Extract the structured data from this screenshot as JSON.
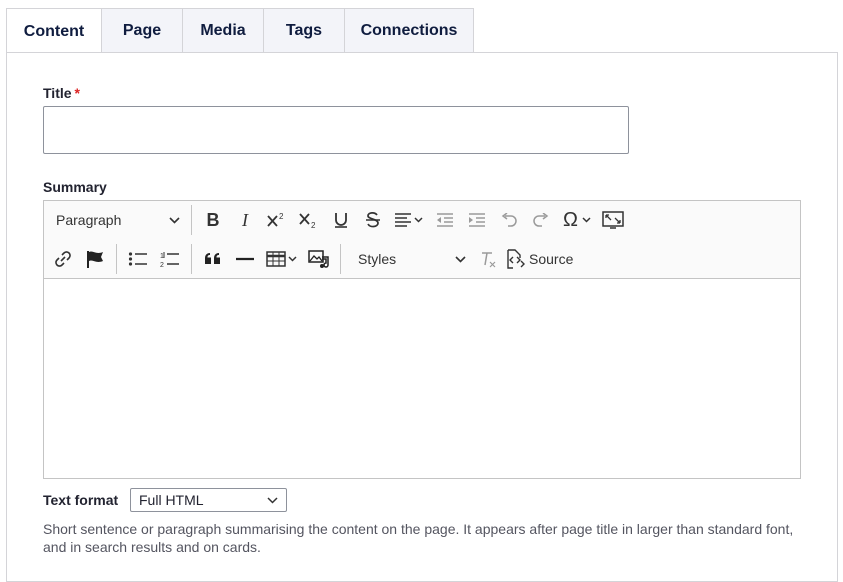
{
  "tabs": [
    {
      "label": "Content",
      "active": true
    },
    {
      "label": "Page",
      "active": false
    },
    {
      "label": "Media",
      "active": false
    },
    {
      "label": "Tags",
      "active": false
    },
    {
      "label": "Connections",
      "active": false
    }
  ],
  "form": {
    "title_label": "Title",
    "required_mark": "*",
    "title_value": "",
    "summary_label": "Summary",
    "text_format_label": "Text format",
    "text_format_value": "Full HTML",
    "help_text": "Short sentence or paragraph summarising the content on the page. It appears after page title in larger than standard font, and in search results and on cards."
  },
  "editor": {
    "heading_dropdown": "Paragraph",
    "styles_dropdown": "Styles",
    "source_label": "Source",
    "icons": {
      "bold": "B",
      "italic": "I",
      "special_chars": "Ω"
    }
  },
  "colors": {
    "accent": "#0f1c3f",
    "required": "#dc2323",
    "border": "#c4c4c4"
  }
}
